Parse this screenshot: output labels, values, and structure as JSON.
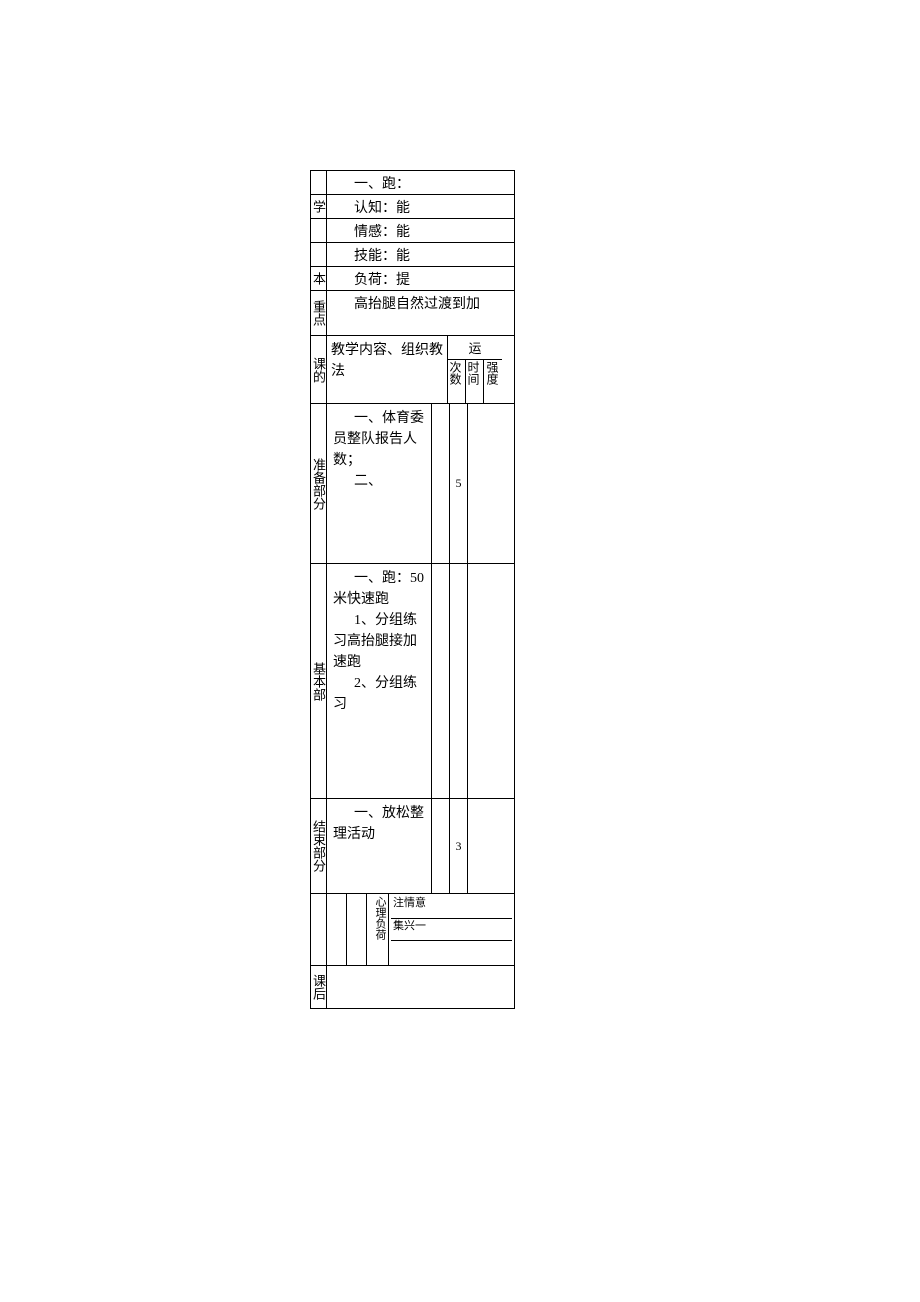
{
  "rows": {
    "r1": "一、跑：",
    "r2_label": "学",
    "r2": "认知：能",
    "r3": "情感：能",
    "r4": "技能：能",
    "r5_label": "本",
    "r5": "负荷：提",
    "r6_label": "重点",
    "r6": "高抬腿自然过渡到加",
    "r7_label": "课的",
    "r7_main": "教学内容、组织教法",
    "r7_right_top": "运",
    "r7_sub1": "次数",
    "r7_sub2": "时间",
    "r7_sub3": "强度",
    "r8_label": "准备部分",
    "r8_main_1": "一、体育委员整队报告人数；",
    "r8_main_2": "二、",
    "r8_time": "5",
    "r9_label": "基本部",
    "r9_main_1": "一、跑：50米快速跑",
    "r9_main_2": "1、分组练习高抬腿接加速跑",
    "r9_main_3": "2、分组练习",
    "r10_label": "结束部分",
    "r10_main": "一、放松整理活动",
    "r10_time": "3",
    "r11_col3": "心理负荷",
    "r11_col4a": "注情意",
    "r11_col4b": "集兴一",
    "r12_label": "课后"
  }
}
